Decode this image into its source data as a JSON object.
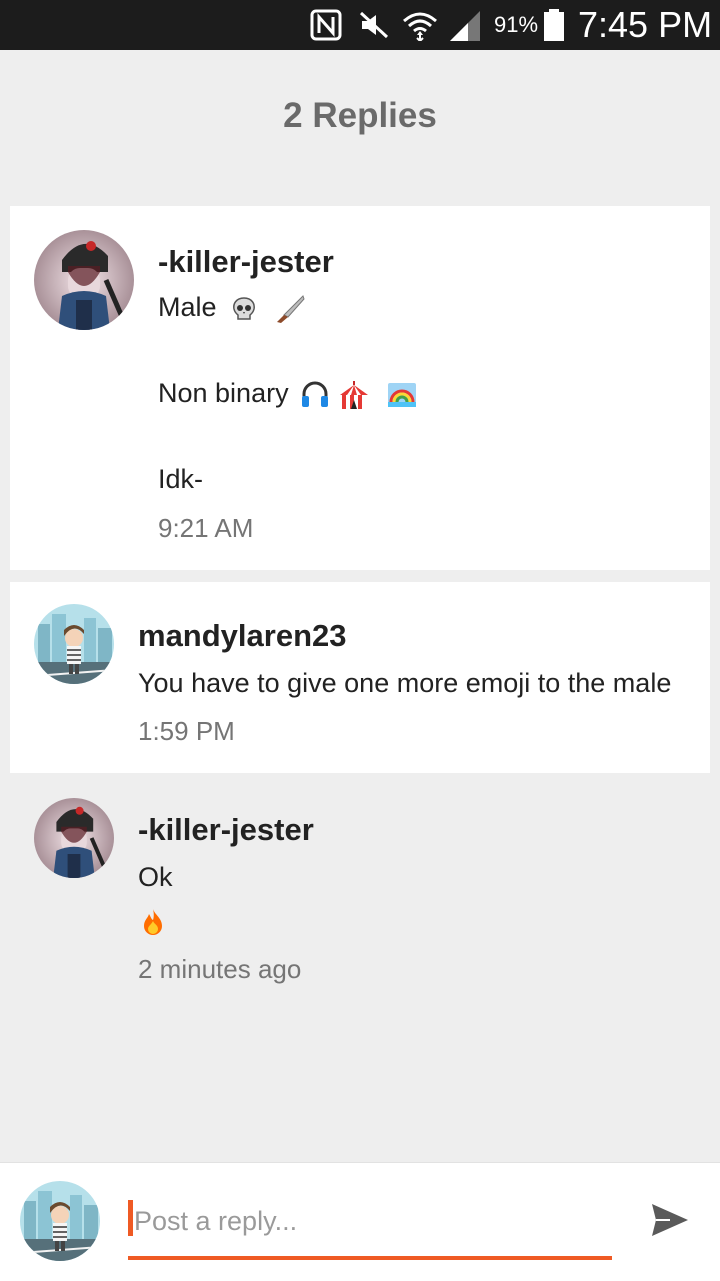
{
  "status_bar": {
    "battery_percent": "91%",
    "time": "7:45 PM",
    "icons": [
      "nfc-icon",
      "mute-icon",
      "wifi-icon",
      "signal-icon",
      "battery-icon"
    ]
  },
  "title": "2 Replies",
  "replies": [
    {
      "username": "-killer-jester",
      "lines": [
        "Male",
        "Non binary",
        "Idk-"
      ],
      "emojis": {
        "line1": [
          "skull",
          "knife"
        ],
        "line2": [
          "headphones",
          "circus-tent",
          "rainbow"
        ]
      },
      "time": "9:21 AM"
    },
    {
      "username": "mandylaren23",
      "lines": [
        "You have to give one more emoji to the male"
      ],
      "time": "1:59 PM"
    },
    {
      "username": "-killer-jester",
      "lines": [
        "Ok"
      ],
      "emojis": {
        "line2": [
          "fire"
        ]
      },
      "time": "2 minutes ago"
    }
  ],
  "composer": {
    "placeholder": "Post a reply...",
    "accent_color": "#ef5a24"
  },
  "colors": {
    "status_bar": "#1c1c1c",
    "background": "#eeeeee",
    "card": "#ffffff"
  }
}
